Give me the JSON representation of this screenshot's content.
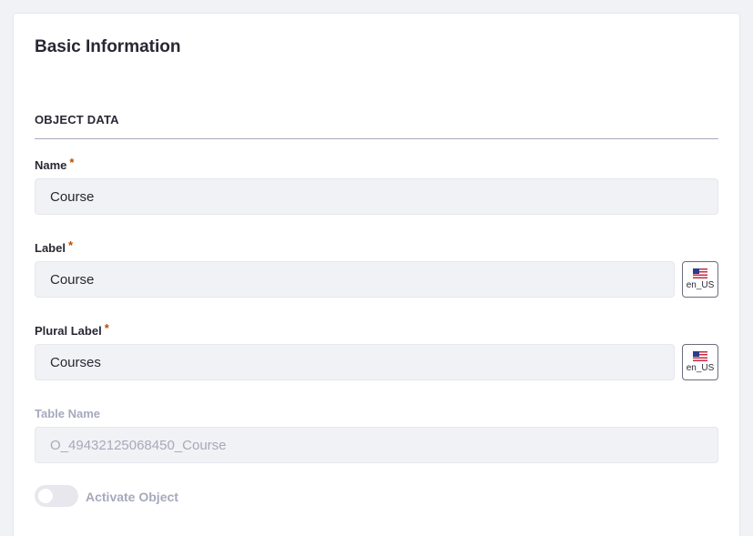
{
  "card": {
    "title": "Basic Information"
  },
  "section": {
    "header": "OBJECT DATA"
  },
  "fields": {
    "name": {
      "label": "Name",
      "required_mark": "*",
      "value": "Course"
    },
    "label": {
      "label": "Label",
      "required_mark": "*",
      "value": "Course",
      "locale": "en_US",
      "locale_icon": "us-flag-icon"
    },
    "plural_label": {
      "label": "Plural Label",
      "required_mark": "*",
      "value": "Courses",
      "locale": "en_US",
      "locale_icon": "us-flag-icon"
    },
    "table_name": {
      "label": "Table Name",
      "value": "O_49432125068450_Course"
    }
  },
  "activate": {
    "label": "Activate Object",
    "enabled": false
  },
  "colors": {
    "required": "#b95000",
    "input_bg": "#f1f2f5",
    "disabled_text": "#a7a9bc"
  }
}
